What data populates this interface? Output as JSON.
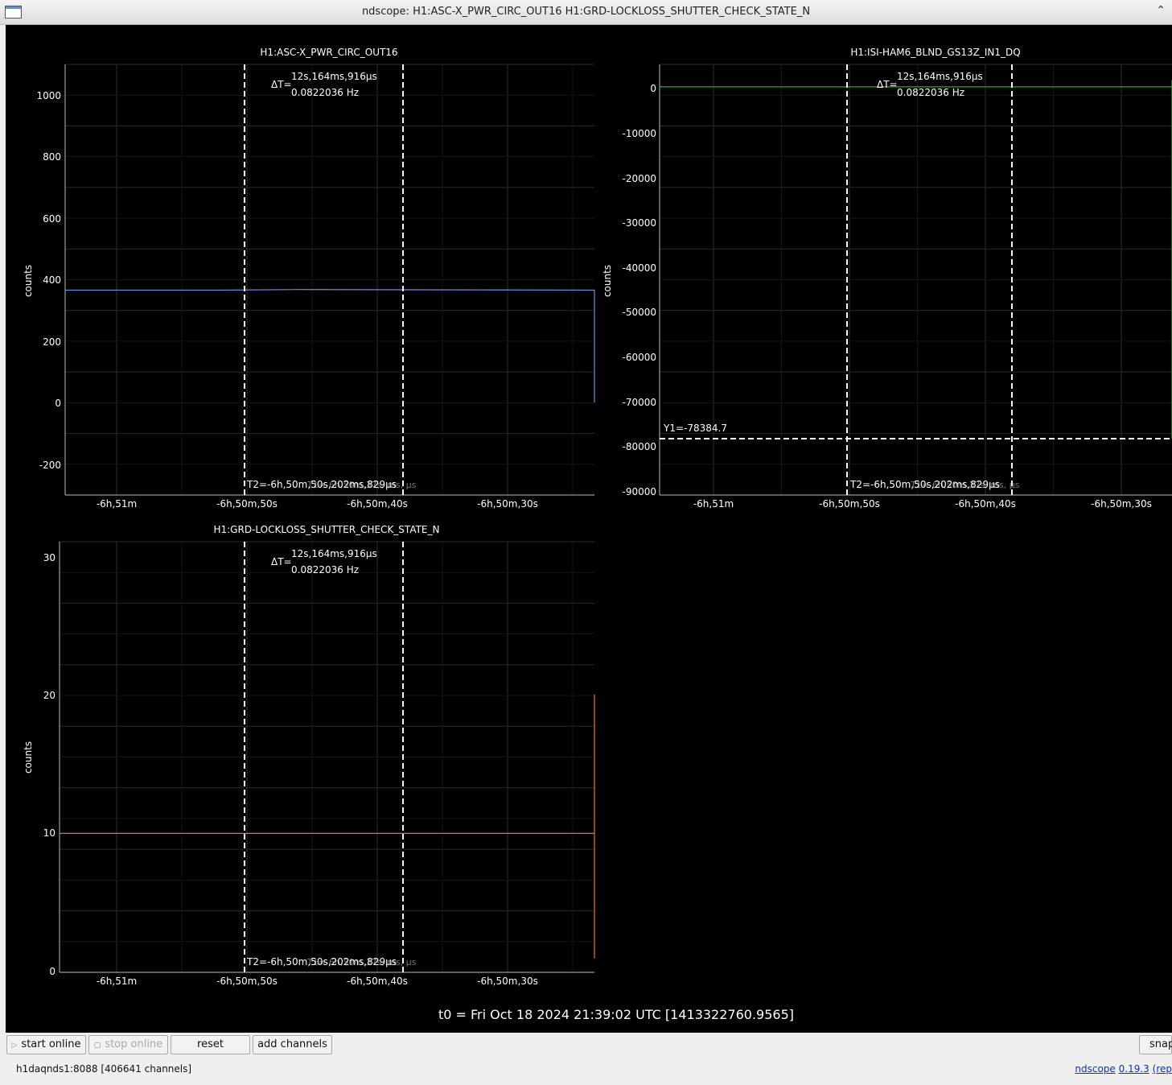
{
  "window": {
    "title": "ndscope: H1:ASC-X_PWR_CIRC_OUT16 H1:GRD-LOCKLOSS_SHUTTER_CHECK_STATE_N",
    "icon": "window-icon",
    "collapse_icon": "chevron-up-icon"
  },
  "cursors": {
    "delta_label": "ΔT=",
    "delta_time": "12s,164ms,916µs",
    "delta_freq": "0.0822036 Hz",
    "t2_label": "T2=-6h,50m,50s,202ms,829µs",
    "t2_ghost": "T1=-6h,50m,37s,  ms,   µs",
    "y1_label": "Y1=-78384.7"
  },
  "x_ticks": [
    "-6h,51m",
    "-6h,50m,50s",
    "-6h,50m,40s",
    "-6h,50m,30s"
  ],
  "t0": "t0 = Fri Oct 18 2024 21:39:02 UTC [1413322760.9565]",
  "chart_data": [
    {
      "type": "line",
      "title": "H1:ASC-X_PWR_CIRC_OUT16",
      "ylabel": "counts",
      "color": "#6f8fd6",
      "ylim": [
        -300,
        1100
      ],
      "yticks": [
        "1000",
        "800",
        "600",
        "400",
        "200",
        "0",
        "-200"
      ],
      "series": [
        {
          "x": [
            -411.7,
            -410.6,
            -410.3,
            -409.1,
            -409.0,
            -408.95,
            -408.8,
            -408.6,
            -408.45,
            -408.3,
            -408.1,
            -407.9,
            -407.7,
            -407.4,
            -406.5
          ],
          "y": [
            366,
            366,
            368,
            366,
            364,
            310,
            200,
            110,
            55,
            25,
            10,
            4,
            1,
            0,
            0
          ]
        }
      ]
    },
    {
      "type": "line",
      "title": "H1:ISI-HAM6_BLND_GS13Z_IN1_DQ",
      "ylabel": "counts",
      "color": "#2fa83a",
      "ylim": [
        -91000,
        5000
      ],
      "yticks": [
        "0",
        "-10000",
        "-20000",
        "-30000",
        "-40000",
        "-50000",
        "-60000",
        "-70000",
        "-80000",
        "-90000"
      ],
      "series": [
        {
          "x": [
            -411.7,
            -408.9,
            -408.8,
            -408.7,
            -408.6,
            -408.5,
            -408.4,
            -408.3,
            -408.2,
            -408.1,
            -407.9,
            -407.7,
            -407.5,
            -406.5,
            -405.5,
            -405.45,
            -405.4,
            -405.0
          ],
          "y": [
            0,
            0,
            -500,
            -78384,
            -1500,
            -1500,
            -500,
            -200,
            -100,
            0,
            0,
            -300,
            0,
            0,
            0,
            -3000,
            1500,
            0
          ]
        }
      ]
    },
    {
      "type": "line",
      "title": "H1:GRD-LOCKLOSS_SHUTTER_CHECK_STATE_N",
      "ylabel": "counts",
      "color": "#e07535",
      "ylim": [
        0,
        31
      ],
      "yticks": [
        "30",
        "20",
        "10",
        "0"
      ],
      "series": [
        {
          "x": [
            -411.7,
            -409.05,
            -409.05,
            -408.52,
            -408.52,
            -406.5
          ],
          "y": [
            10,
            10,
            20,
            20,
            1,
            1
          ]
        }
      ]
    }
  ],
  "toolbar": {
    "start_online": "start online",
    "stop_online": "stop online",
    "reset": "reset",
    "add_channels": "add channels",
    "snap": "snap",
    "start_icon": "play-icon",
    "stop_icon": "stop-icon"
  },
  "status": {
    "server": "h1daqnds1:8088  [406641 channels]",
    "app_link": "ndscope",
    "version_link": "0.19.3",
    "repo_link": "(rep"
  }
}
